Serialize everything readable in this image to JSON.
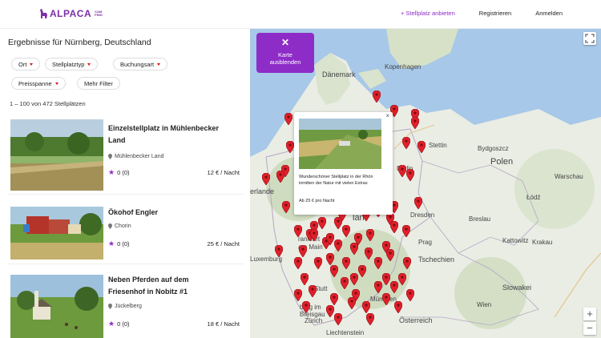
{
  "header": {
    "logo_text": "ALPACA",
    "logo_sub1": "CAM",
    "logo_sub2": "PING",
    "add_label": "+ Stellplatz anbieten",
    "register_label": "Registrieren",
    "login_label": "Anmelden",
    "accent_color": "#8e2cc8"
  },
  "results": {
    "title": "Ergebnisse für Nürnberg, Deutschland",
    "count": "1 – 100 von 472 Stellplätzen"
  },
  "filters": [
    "Ort",
    "Stellplatztyp",
    "Buchungsart",
    "Preisspanne",
    "Mehr Filter"
  ],
  "listings": [
    {
      "title_line1": "Einzelstellplatz in Mühlenbecker",
      "title_line2": "Land",
      "location": "Mühlenbecker Land",
      "rating": "0 (0)",
      "price": "12 € / Nacht"
    },
    {
      "title_line1": "Ökohof Engler",
      "title_line2": "",
      "location": "Chorin",
      "rating": "0 (0)",
      "price": "25 € / Nacht"
    },
    {
      "title_line1": "Neben Pferden auf dem",
      "title_line2": "Friesenhof in Nobitz #1",
      "location": "Jückelberg",
      "rating": "0 (0)",
      "price": "18 € / Nacht"
    }
  ],
  "map": {
    "hide_label_line1": "Karte",
    "hide_label_line2": "ausblenden",
    "labels": {
      "daenemark": "Dänemark",
      "kopenhagen": "Kopenhagen",
      "stettin": "Stettin",
      "bydgoszcz": "Bydgoszcz",
      "polen": "Polen",
      "berlin": "Berlin",
      "warschau": "Warschau",
      "lodz": "Łódź",
      "breslau": "Breslau",
      "dresden": "Dresden",
      "prag": "Prag",
      "kattowitz": "Kattowitz",
      "krakau": "Krakau",
      "tschechien": "Tschechien",
      "slowakei": "Slowakei",
      "wien": "Wien",
      "oesterreich": "Österreich",
      "muenchen": "München",
      "stuttgart": "Stutt",
      "frankfurt": "rankfurt",
      "luxemburg": "Luxemburg",
      "niederlande": "erlande",
      "zuerich": "Zürich",
      "liechtenstein": "Liechtenstein",
      "germany": "lan",
      "freiburg": "burg im",
      "freiburg2": "Breisgau",
      "main": "am Main"
    },
    "zoom_in": "+",
    "zoom_out": "−",
    "marker_color": "#e0202a"
  },
  "popup": {
    "text": "Wunderschöner Stellplatz in der Rhön inmitten der Natur mit vielen Extras",
    "price": "Ab 25 € pro Nacht",
    "close": "×"
  }
}
